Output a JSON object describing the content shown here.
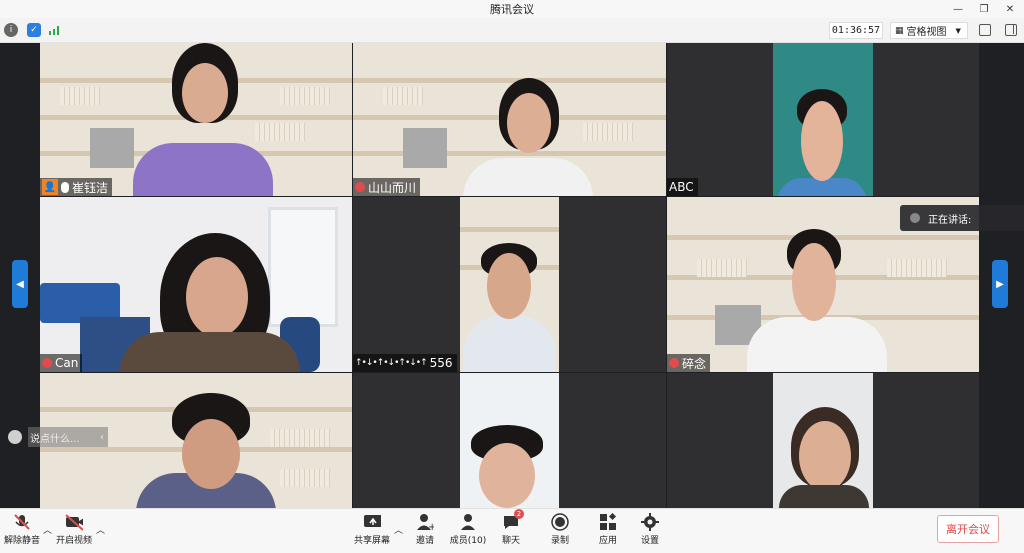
{
  "window": {
    "title": "腾讯会议",
    "controls": [
      "minimize-icon",
      "restore-icon",
      "close-icon"
    ]
  },
  "top_toolbar": {
    "icons": [
      "info-icon",
      "security-shield-icon",
      "signal-strength-icon"
    ],
    "timer": "01:36:57",
    "view_label": "宫格视图",
    "fullscreen_icon": "fullscreen-icon",
    "sidebar_toggle_icon": "sidebar-toggle-icon"
  },
  "participants": [
    {
      "name": "崔钰洁",
      "mic": "on",
      "host": true
    },
    {
      "name": "山山而川",
      "mic": "muted"
    },
    {
      "name": "ABC",
      "mic": "none"
    },
    {
      "name": "Can",
      "mic": "muted"
    },
    {
      "name": "556",
      "mic": "none"
    },
    {
      "name": "碎念",
      "mic": "muted"
    },
    {
      "name": "",
      "mic": "none"
    },
    {
      "name": "",
      "mic": "none"
    },
    {
      "name": "",
      "mic": "none"
    }
  ],
  "speaking_indicator": {
    "label": "正在讲话:"
  },
  "chat": {
    "placeholder": "说点什么..."
  },
  "bottom_toolbar": {
    "mute_label": "解除静音",
    "video_label": "开启视频",
    "share_label": "共享屏幕",
    "invite_label": "邀请",
    "members_label": "成员(10)",
    "chat_label": "聊天",
    "chat_badge": "2",
    "record_label": "录制",
    "apps_label": "应用",
    "settings_label": "设置",
    "leave_label": "离开会议"
  },
  "colors": {
    "accent": "#1f7ad8",
    "danger": "#e04545",
    "host": "#f08324"
  }
}
